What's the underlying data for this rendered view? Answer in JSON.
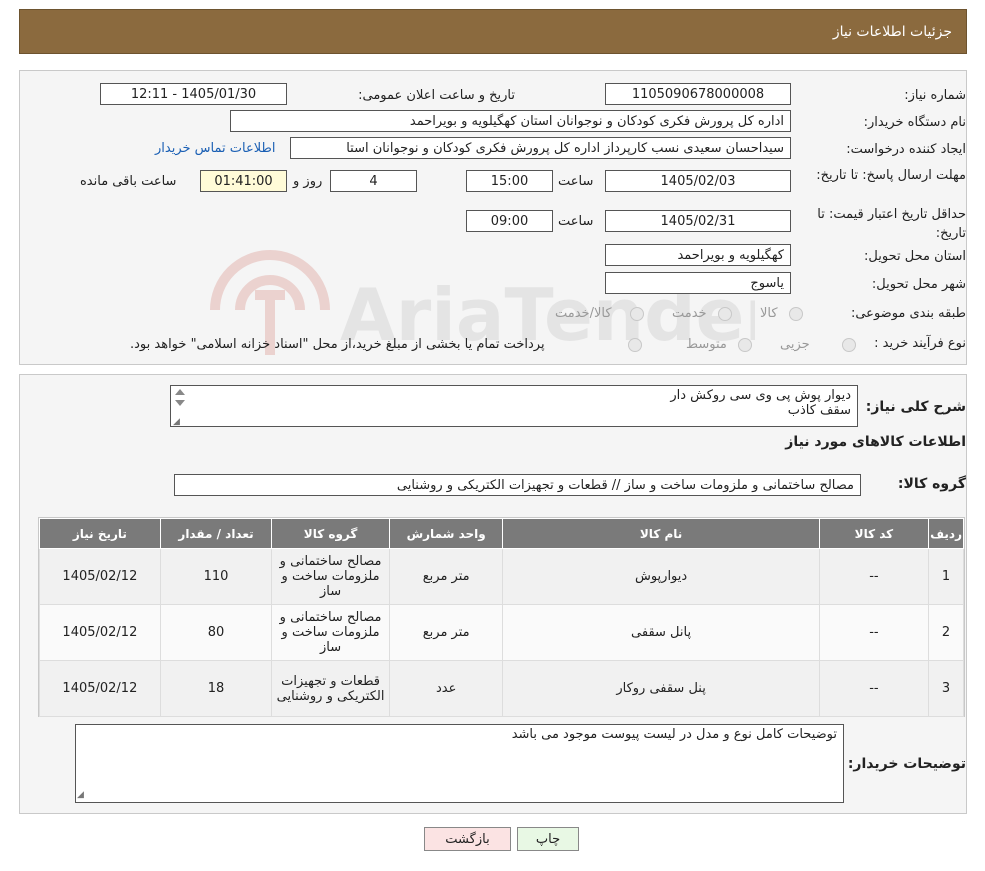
{
  "header": {
    "title": "جزئیات اطلاعات نیاز"
  },
  "form": {
    "need_number_label": "شماره نیاز:",
    "need_number": "1105090678000008",
    "announce_label": "تاریخ و ساعت اعلان عمومی:",
    "announce_value": "1405/01/30 - 12:11",
    "buyer_org_label": "نام دستگاه خریدار:",
    "buyer_org": "اداره کل پرورش فکری کودکان و نوجوانان استان کهگیلویه و بویراحمد",
    "requester_label": "ایجاد کننده درخواست:",
    "requester": "سیداحسان سعیدی نسب کارپرداز اداره کل پرورش فکری کودکان و نوجوانان استا",
    "contact_link": "اطلاعات تماس خریدار",
    "reply_deadline_label": "مهلت ارسال پاسخ: تا تاریخ:",
    "reply_date": "1405/02/03",
    "time_label": "ساعت",
    "reply_time": "15:00",
    "days_value": "4",
    "days_label": "روز و",
    "remaining_time": "01:41:00",
    "remaining_label": "ساعت باقی مانده",
    "price_validity_label": "حداقل تاریخ اعتبار قیمت: تا تاریخ:",
    "price_date": "1405/02/31",
    "price_time": "09:00",
    "province_label": "استان محل تحویل:",
    "province": "کهگیلویه و بویراحمد",
    "city_label": "شهر محل تحویل:",
    "city": "یاسوج",
    "category_label": "طبقه بندی موضوعی:",
    "category_options": [
      "کالا",
      "خدمت",
      "کالا/خدمت"
    ],
    "process_label": "نوع فرآیند خرید :",
    "process_options": [
      "جزیی",
      "متوسط"
    ],
    "process_note": "پرداخت تمام یا بخشی از مبلغ خرید،از محل \"اسناد خزانه اسلامی\" خواهد بود."
  },
  "description": {
    "label": "شرح کلی نیاز:",
    "lines": [
      "دیوار پوش پی وی سی روکش دار",
      "سقف کاذب"
    ]
  },
  "goods": {
    "section_title": "اطلاعات کالاهای مورد نیاز",
    "group_label": "گروه کالا:",
    "group_value": "مصالح ساختمانی و ملزومات ساخت و ساز // قطعات و تجهیزات الکتریکی و روشنایی",
    "columns": [
      "ردیف",
      "کد کالا",
      "نام کالا",
      "واحد شمارش",
      "گروه کالا",
      "تعداد / مقدار",
      "تاریخ نیاز"
    ],
    "rows": [
      {
        "idx": "1",
        "code": "--",
        "name": "دیوارپوش",
        "unit": "متر مربع",
        "group": "مصالح ساختمانی و ملزومات ساخت و ساز",
        "qty": "110",
        "date": "1405/02/12"
      },
      {
        "idx": "2",
        "code": "--",
        "name": "پانل سقفی",
        "unit": "متر مربع",
        "group": "مصالح ساختمانی و ملزومات ساخت و ساز",
        "qty": "80",
        "date": "1405/02/12"
      },
      {
        "idx": "3",
        "code": "--",
        "name": "پنل سقفی روکار",
        "unit": "عدد",
        "group": "قطعات و تجهیزات الکتریکی و روشنایی",
        "qty": "18",
        "date": "1405/02/12"
      }
    ]
  },
  "buyer_notes": {
    "label": "توضیحات خریدار:",
    "text": "توضیحات کامل نوع و مدل در لیست پیوست موجود می باشد"
  },
  "buttons": {
    "print": "چاپ",
    "back": "بازگشت"
  },
  "watermark": {
    "text": "AriaTender.neT"
  },
  "colors": {
    "header_bg": "#8b6a3e",
    "table_header_bg": "#7a7a7a",
    "link": "#1a5fb4"
  }
}
